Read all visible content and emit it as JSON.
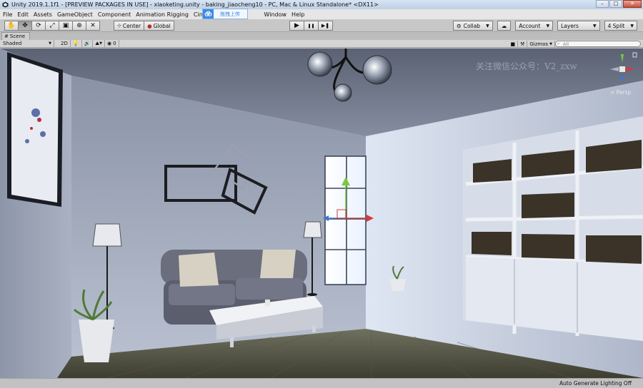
{
  "window": {
    "title": "Unity 2019.1.1f1 - [PREVIEW PACKAGES IN USE] - xiaoketing.unity - baking_jiaocheng10 - PC, Mac & Linux Standalone* <DX11>",
    "minimize": "–",
    "maximize": "□",
    "close": "✕"
  },
  "menu": [
    "File",
    "Edit",
    "Assets",
    "GameObject",
    "Component",
    "Animation Rigging",
    "Cinem",
    "Window",
    "Help"
  ],
  "cloud_upload": {
    "label": "拖拽上传",
    "icon": "cloud-upload-icon"
  },
  "toolbar": {
    "tools": [
      "hand-icon",
      "move-icon",
      "rotate-icon",
      "scale-icon",
      "rect-icon",
      "transform-icon",
      "custom-tool-icon"
    ],
    "active_tool": "move-icon",
    "pivot": "Center",
    "space": "Global",
    "play": "▶",
    "pause": "❚❚",
    "step": "▶❚",
    "collab": "Collab",
    "account": "Account",
    "layers": "Layers",
    "layout": "4 Split"
  },
  "scene": {
    "tab_label": "Scene",
    "shading": "Shaded",
    "mode_2d": "2D",
    "effects_count": "0",
    "gizmos": "Gizmos",
    "search_placeholder": "All",
    "projection": "Persp"
  },
  "overlay": {
    "watermark": "关注微信公众号：V2_zxw"
  },
  "status": {
    "text": "Auto Generate Lighting Off"
  },
  "colors": {
    "accent": "#3c8be2",
    "x_axis": "#d9393b",
    "y_axis": "#7ac943",
    "z_axis": "#3a76d8"
  }
}
